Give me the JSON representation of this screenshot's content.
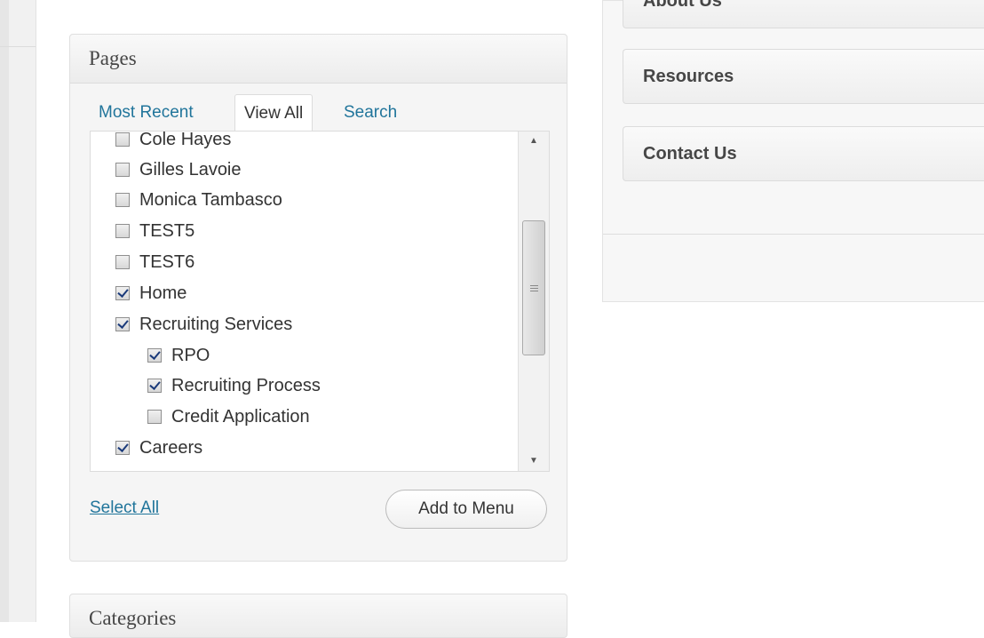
{
  "pages_panel": {
    "title": "Pages",
    "tabs": [
      {
        "label": "Most Recent"
      },
      {
        "label": "View All"
      },
      {
        "label": "Search"
      }
    ],
    "items": [
      {
        "label": "Cole Hayes",
        "checked": false,
        "level": 0
      },
      {
        "label": "Gilles Lavoie",
        "checked": false,
        "level": 0
      },
      {
        "label": "Monica Tambasco",
        "checked": false,
        "level": 0
      },
      {
        "label": "TEST5",
        "checked": false,
        "level": 0
      },
      {
        "label": "TEST6",
        "checked": false,
        "level": 0
      },
      {
        "label": "Home",
        "checked": true,
        "level": 0
      },
      {
        "label": "Recruiting Services",
        "checked": true,
        "level": 0
      },
      {
        "label": "RPO",
        "checked": true,
        "level": 1
      },
      {
        "label": "Recruiting Process",
        "checked": true,
        "level": 1
      },
      {
        "label": "Credit Application",
        "checked": false,
        "level": 1
      },
      {
        "label": "Careers",
        "checked": true,
        "level": 0
      }
    ],
    "select_all_label": "Select All",
    "add_button_label": "Add to Menu"
  },
  "categories_panel": {
    "title": "Categories"
  },
  "menu_structure": {
    "items": [
      {
        "label": "About Us"
      },
      {
        "label": "Resources"
      },
      {
        "label": "Contact Us"
      }
    ]
  },
  "colors": {
    "link": "#21759b",
    "text": "#333333",
    "panel_bg": "#f5f5f5"
  },
  "icons": {
    "scroll_up": "arrow-up-icon",
    "scroll_down": "arrow-down-icon",
    "scroll_grip": "grip-icon"
  }
}
